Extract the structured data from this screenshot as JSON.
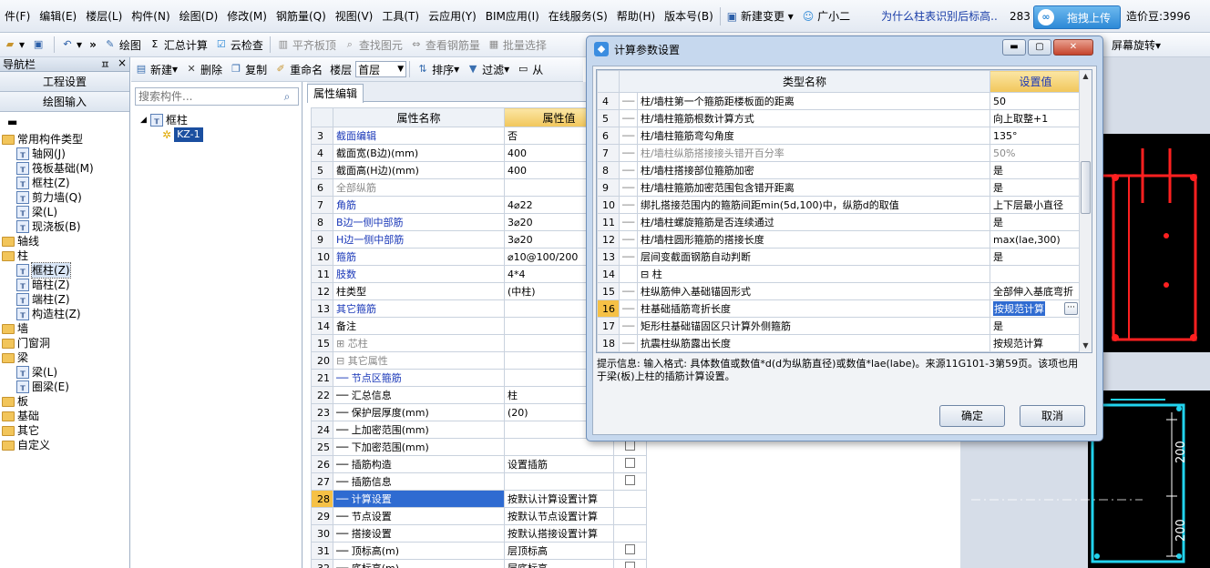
{
  "menu": {
    "items": [
      "件(F)",
      "编辑(E)",
      "楼层(L)",
      "构件(N)",
      "绘图(D)",
      "修改(M)",
      "钢筋量(Q)",
      "视图(V)",
      "工具(T)",
      "云应用(Y)",
      "BIM应用(I)",
      "在线服务(S)",
      "帮助(H)",
      "版本号(B)"
    ],
    "new_change": "新建变更",
    "assistant": "广小二",
    "question_link": "为什么柱表识别后标高..",
    "count": "283",
    "upload_label": "拖拽上传",
    "coins": "造价豆:3996"
  },
  "toolbar": {
    "draw": "绘图",
    "sum_calc": "汇总计算",
    "cloud_check": "云检查",
    "flat_slab": "平齐板顶",
    "find_element": "查找图元",
    "view_rebar": "查看钢筋量",
    "batch_select": "批量选择",
    "screen_rotate": "屏幕旋转"
  },
  "nav": {
    "header": "导航栏",
    "pin": "ㅍ",
    "close": "×",
    "btn_project": "工程设置",
    "btn_draw": "绘图输入",
    "tree": [
      {
        "label": "常用构件类型",
        "level": 0,
        "icon": "folder-icon"
      },
      {
        "label": "轴网(J)",
        "level": 1,
        "icon": "grid-axis-icon"
      },
      {
        "label": "筏板基础(M)",
        "level": 1,
        "icon": "raft-foundation-icon"
      },
      {
        "label": "框柱(Z)",
        "level": 1,
        "icon": "frame-column-icon"
      },
      {
        "label": "剪力墙(Q)",
        "level": 1,
        "icon": "shear-wall-icon"
      },
      {
        "label": "梁(L)",
        "level": 1,
        "icon": "beam-icon"
      },
      {
        "label": "现浇板(B)",
        "level": 1,
        "icon": "slab-icon"
      },
      {
        "label": "轴线",
        "level": 0,
        "icon": "folder-icon"
      },
      {
        "label": "柱",
        "level": 0,
        "icon": "folder-icon"
      },
      {
        "label": "框柱(Z)",
        "level": 1,
        "icon": "frame-column-icon",
        "selected": true
      },
      {
        "label": "暗柱(Z)",
        "level": 1,
        "icon": "hidden-column-icon"
      },
      {
        "label": "端柱(Z)",
        "level": 1,
        "icon": "end-column-icon"
      },
      {
        "label": "构造柱(Z)",
        "level": 1,
        "icon": "construction-column-icon"
      },
      {
        "label": "墙",
        "level": 0,
        "icon": "folder-icon"
      },
      {
        "label": "门窗洞",
        "level": 0,
        "icon": "folder-icon"
      },
      {
        "label": "梁",
        "level": 0,
        "icon": "folder-icon"
      },
      {
        "label": "梁(L)",
        "level": 1,
        "icon": "beam-icon"
      },
      {
        "label": "圈梁(E)",
        "level": 1,
        "icon": "ring-beam-icon"
      },
      {
        "label": "板",
        "level": 0,
        "icon": "folder-icon"
      },
      {
        "label": "基础",
        "level": 0,
        "icon": "folder-icon"
      },
      {
        "label": "其它",
        "level": 0,
        "icon": "folder-icon"
      },
      {
        "label": "自定义",
        "level": 0,
        "icon": "folder-icon"
      }
    ]
  },
  "comp_toolbar": {
    "new": "新建",
    "delete": "删除",
    "copy": "复制",
    "rename": "重命名",
    "floor_label": "楼层",
    "floor_value": "首层",
    "sort": "排序",
    "filter": "过滤",
    "from": "从"
  },
  "comp": {
    "search_placeholder": "搜索构件...",
    "root": "框柱",
    "item": "KZ-1"
  },
  "prop": {
    "tab": "属性编辑",
    "col_name": "属性名称",
    "col_value": "属性值",
    "rows": [
      {
        "n": "3",
        "name": "截面编辑",
        "value": "否",
        "style": "blue"
      },
      {
        "n": "4",
        "name": "截面宽(B边)(mm)",
        "value": "400"
      },
      {
        "n": "5",
        "name": "截面高(H边)(mm)",
        "value": "400"
      },
      {
        "n": "6",
        "name": "全部纵筋",
        "value": "",
        "style": "gray"
      },
      {
        "n": "7",
        "name": "角筋",
        "value": "4⌀22",
        "style": "blue"
      },
      {
        "n": "8",
        "name": "B边一侧中部筋",
        "value": "3⌀20",
        "style": "blue"
      },
      {
        "n": "9",
        "name": "H边一侧中部筋",
        "value": "3⌀20",
        "style": "blue"
      },
      {
        "n": "10",
        "name": "箍筋",
        "value": "⌀10@100/200",
        "style": "blue"
      },
      {
        "n": "11",
        "name": "肢数",
        "value": "4*4",
        "style": "blue"
      },
      {
        "n": "12",
        "name": "柱类型",
        "value": "(中柱)"
      },
      {
        "n": "13",
        "name": "其它箍筋",
        "value": "",
        "style": "blue"
      },
      {
        "n": "14",
        "name": "备注",
        "value": ""
      },
      {
        "n": "15",
        "name": "⊞ 芯柱",
        "value": "",
        "style": "gray"
      },
      {
        "n": "20",
        "name": "⊟ 其它属性",
        "value": "",
        "style": "gray"
      },
      {
        "n": "21",
        "name": "── 节点区箍筋",
        "value": "",
        "style": "blue"
      },
      {
        "n": "22",
        "name": "── 汇总信息",
        "value": "柱"
      },
      {
        "n": "23",
        "name": "── 保护层厚度(mm)",
        "value": "(20)"
      },
      {
        "n": "24",
        "name": "── 上加密范围(mm)",
        "value": ""
      },
      {
        "n": "25",
        "name": "── 下加密范围(mm)",
        "value": "",
        "cb": true
      },
      {
        "n": "26",
        "name": "── 插筋构造",
        "value": "设置插筋",
        "cb": true
      },
      {
        "n": "27",
        "name": "── 插筋信息",
        "value": "",
        "cb": true
      },
      {
        "n": "28",
        "name": "── 计算设置",
        "value": "按默认计算设置计算",
        "selected": true
      },
      {
        "n": "29",
        "name": "── 节点设置",
        "value": "按默认节点设置计算"
      },
      {
        "n": "30",
        "name": "── 搭接设置",
        "value": "按默认搭接设置计算"
      },
      {
        "n": "31",
        "name": "── 顶标高(m)",
        "value": "层顶标高",
        "cb": true
      },
      {
        "n": "32",
        "name": "── 底标高(m)",
        "value": "层底标高",
        "cb": true
      }
    ]
  },
  "dialog": {
    "title": "计算参数设置",
    "col_name": "类型名称",
    "col_value": "设置值",
    "rows": [
      {
        "n": "4",
        "name": "柱/墙柱第一个箍筋距楼板面的距离",
        "value": "50"
      },
      {
        "n": "5",
        "name": "柱/墙柱箍筋根数计算方式",
        "value": "向上取整+1"
      },
      {
        "n": "6",
        "name": "柱/墙柱箍筋弯勾角度",
        "value": "135°"
      },
      {
        "n": "7",
        "name": "柱/墙柱纵筋搭接接头错开百分率",
        "value": "50%",
        "gray": true
      },
      {
        "n": "8",
        "name": "柱/墙柱搭接部位箍筋加密",
        "value": "是"
      },
      {
        "n": "9",
        "name": "柱/墙柱箍筋加密范围包含错开距离",
        "value": "是"
      },
      {
        "n": "10",
        "name": "绑扎搭接范围内的箍筋间距min(5d,100)中，纵筋d的取值",
        "value": "上下层最小直径"
      },
      {
        "n": "11",
        "name": "柱/墙柱螺旋箍筋是否连续通过",
        "value": "是"
      },
      {
        "n": "12",
        "name": "柱/墙柱圆形箍筋的搭接长度",
        "value": "max(lae,300)"
      },
      {
        "n": "13",
        "name": "层间变截面钢筋自动判断",
        "value": "是"
      },
      {
        "n": "14",
        "name": "⊟ 柱",
        "value": "",
        "section": true
      },
      {
        "n": "15",
        "name": "柱纵筋伸入基础锚固形式",
        "value": "全部伸入基底弯折"
      },
      {
        "n": "16",
        "name": "柱基础插筋弯折长度",
        "value": "按规范计算",
        "current": true
      },
      {
        "n": "17",
        "name": "矩形柱基础锚固区只计算外侧箍筋",
        "value": "是"
      },
      {
        "n": "18",
        "name": "抗震柱纵筋露出长度",
        "value": "按规范计算"
      }
    ],
    "hint": "提示信息: 输入格式: 具体数值或数值*d(d为纵筋直径)或数值*lae(labe)。来源11G101-3第59页。该项也用于梁(板)上柱的插筋计算设置。",
    "ok": "确定",
    "cancel": "取消"
  },
  "cad": {
    "dim_top": "200",
    "dim_bottom": "200"
  },
  "colors": {
    "accent_blue": "#2f6bd1",
    "header_gold": "#f1c65a",
    "cad_red": "#ff2020",
    "cad_cyan": "#22d3ee"
  }
}
